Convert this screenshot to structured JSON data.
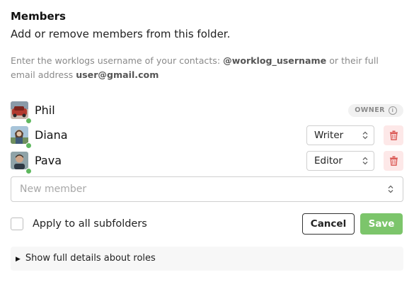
{
  "header": {
    "title": "Members",
    "subtitle": "Add or remove members from this folder."
  },
  "hint": {
    "prefix": "Enter the worklogs username of your contacts: ",
    "username_example": "@worklog_username",
    "middle": " or their full email address ",
    "email_example": "user@gmail.com"
  },
  "members": [
    {
      "name": "Phil",
      "badge": "OWNER",
      "online": true,
      "avatar_icon": "user-avatar-icon"
    },
    {
      "name": "Diana",
      "role": "Writer",
      "online": true,
      "avatar_icon": "user-avatar-icon"
    },
    {
      "name": "Pava",
      "role": "Editor",
      "online": true,
      "avatar_icon": "user-avatar-icon"
    }
  ],
  "new_member": {
    "placeholder": "New member"
  },
  "apply": {
    "label": "Apply to all subfolders",
    "checked": false
  },
  "buttons": {
    "cancel": "Cancel",
    "save": "Save"
  },
  "details": {
    "label": "Show full details about roles"
  },
  "colors": {
    "accent_green": "#7cc56b",
    "online_green": "#5fb85f",
    "delete_bg": "#fde8e8",
    "delete_icon": "#d9534f"
  },
  "icons": {
    "info": "info-icon",
    "chevron": "chevron-updown-icon",
    "delete": "trash-icon",
    "disclosure": "triangle-right-icon"
  }
}
